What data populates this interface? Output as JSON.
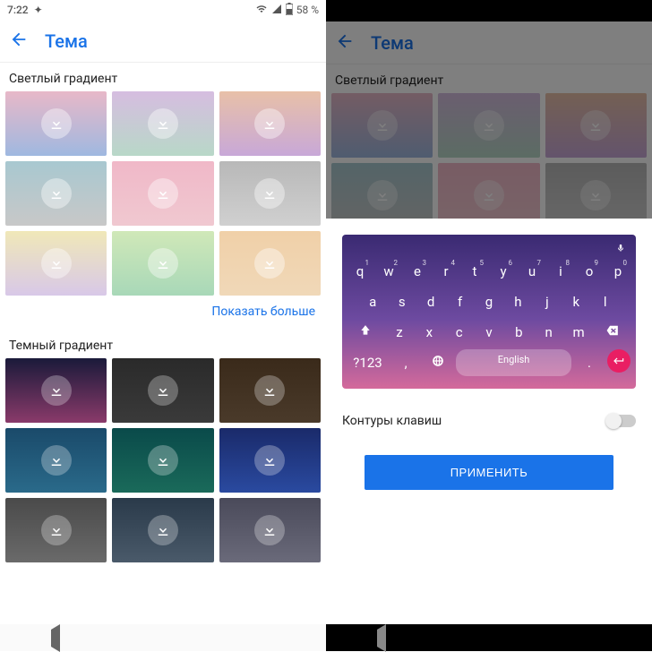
{
  "left": {
    "status": {
      "time": "7:22",
      "battery": "58 %"
    },
    "appbar": {
      "title": "Тема"
    },
    "section_light": "Светлый градиент",
    "section_dark": "Темный градиент",
    "show_more": "Показать больше",
    "light_tiles": [
      "linear-gradient(180deg,#e8b8c8 0%,#9fb8e0 100%)",
      "linear-gradient(180deg,#d6bde0 0%,#b8d8c8 100%)",
      "linear-gradient(180deg,#e8c0a8 0%,#c8a8d8 100%)",
      "linear-gradient(180deg,#a8c8d0 0%,#c8c8c8 100%)",
      "linear-gradient(180deg,#f0b8c8 0%,#f0c8d0 100%)",
      "linear-gradient(180deg,#b8b8b8 0%,#d0d0d0 100%)",
      "linear-gradient(180deg,#f0e8b8 0%,#d8c8e8 100%)",
      "linear-gradient(180deg,#d0e8b8 0%,#a8d8b8 100%)",
      "linear-gradient(180deg,#f0d0a8 0%,#f0d8b8 100%)"
    ],
    "dark_tiles": [
      "linear-gradient(180deg,#1a1a3a 0%,#8a3a6a 100%)",
      "linear-gradient(180deg,#2a2a2a 0%,#3a3a3a 100%)",
      "linear-gradient(180deg,#3a2a1a 0%,#4a3a2a 100%)",
      "linear-gradient(180deg,#1a4a6a 0%,#2a6a8a 100%)",
      "linear-gradient(180deg,#0a4a4a 0%,#1a6a5a 100%)",
      "linear-gradient(180deg,#1a2a6a 0%,#2a4aa0 100%)",
      "linear-gradient(180deg,#4a4a4a 0%,#6a6a6a 100%)",
      "linear-gradient(180deg,#2a3a4a 0%,#4a5a6a 100%)",
      "linear-gradient(180deg,#4a4a5a 0%,#6a6a7a 100%)"
    ]
  },
  "right": {
    "appbar": {
      "title": "Тема"
    },
    "section_light": "Светлый градиент",
    "light_tiles": [
      "linear-gradient(180deg,#e8b8c8 0%,#9fb8e0 100%)",
      "linear-gradient(180deg,#d6bde0 0%,#b8d8c8 100%)",
      "linear-gradient(180deg,#e8c0a8 0%,#c8a8d8 100%)",
      "linear-gradient(180deg,#a8c8d0 0%,#c8c8c8 100%)",
      "linear-gradient(180deg,#f0b8c8 0%,#f0c8d0 100%)",
      "linear-gradient(180deg,#b8b8b8 0%,#d0d0d0 100%)"
    ],
    "keyboard": {
      "row1": [
        {
          "k": "q",
          "n": "1"
        },
        {
          "k": "w",
          "n": "2"
        },
        {
          "k": "e",
          "n": "3"
        },
        {
          "k": "r",
          "n": "4"
        },
        {
          "k": "t",
          "n": "5"
        },
        {
          "k": "y",
          "n": "6"
        },
        {
          "k": "u",
          "n": "7"
        },
        {
          "k": "i",
          "n": "8"
        },
        {
          "k": "o",
          "n": "9"
        },
        {
          "k": "p",
          "n": "0"
        }
      ],
      "row2": [
        "a",
        "s",
        "d",
        "f",
        "g",
        "h",
        "j",
        "k",
        "l"
      ],
      "row3": [
        "z",
        "x",
        "c",
        "v",
        "b",
        "n",
        "m"
      ],
      "numkey": "?123",
      "space": "English",
      "comma": ",",
      "period": "."
    },
    "toggle_label": "Контуры клавиш",
    "apply": "ПРИМЕНИТЬ"
  }
}
